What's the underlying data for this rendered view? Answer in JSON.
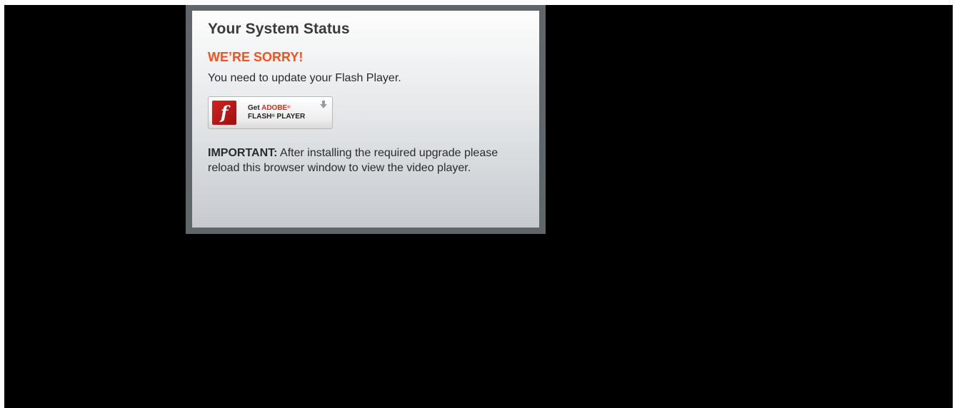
{
  "status_panel": {
    "title": "Your System Status",
    "error_heading": "WE’RE SORRY!",
    "message": "You need to update your Flash Player.",
    "flash_button": {
      "logo_glyph": "f",
      "get_label": "Get",
      "brand": "ADOBE",
      "brand_mark": "®",
      "product": "FLASH",
      "product_mark": "®",
      "product_suffix": "PLAYER",
      "icon": "download-arrow-icon"
    },
    "note_label": "IMPORTANT:",
    "note_text": "After installing the required upgrade please reload this browser window to view the video player."
  },
  "colors": {
    "page_background": "#000000",
    "frame": "#5f6568",
    "error_accent": "#f4511e",
    "flash_red": "#c41a1a"
  }
}
